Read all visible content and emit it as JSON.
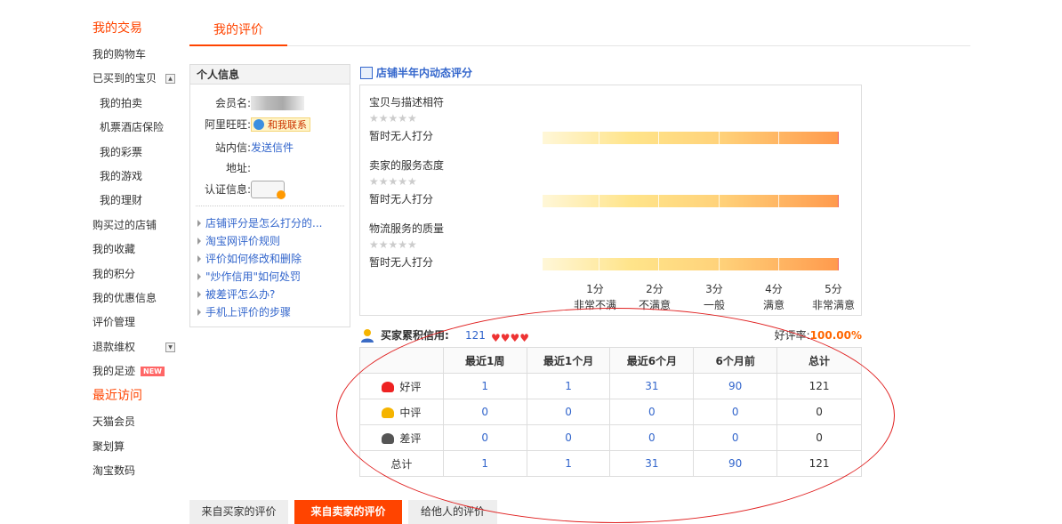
{
  "nav": {
    "heading_trade": "我的交易",
    "items": [
      {
        "label": "我的购物车",
        "sub": false
      },
      {
        "label": "已买到的宝贝",
        "sub": false,
        "toggle": "▲"
      },
      {
        "label": "我的拍卖",
        "sub": true
      },
      {
        "label": "机票酒店保险",
        "sub": true
      },
      {
        "label": "我的彩票",
        "sub": true
      },
      {
        "label": "我的游戏",
        "sub": true
      },
      {
        "label": "我的理财",
        "sub": true
      },
      {
        "label": "购买过的店铺",
        "sub": false
      },
      {
        "label": "我的收藏",
        "sub": false
      },
      {
        "label": "我的积分",
        "sub": false
      },
      {
        "label": "我的优惠信息",
        "sub": false
      },
      {
        "label": "评价管理",
        "sub": false
      },
      {
        "label": "退款维权",
        "sub": false,
        "toggle": "▼"
      },
      {
        "label": "我的足迹",
        "sub": false,
        "badge": "NEW"
      }
    ],
    "heading_recent": "最近访问",
    "recent": [
      "天猫会员",
      "聚划算",
      "淘宝数码"
    ]
  },
  "top_tab": "我的评价",
  "info": {
    "title": "个人信息",
    "member_label": "会员名:",
    "wangwang_label": "阿里旺旺:",
    "wangwang_btn": "和我联系",
    "message_label": "站内信:",
    "message_link": "发送信件",
    "address_label": "地址:",
    "cert_label": "认证信息:",
    "help": [
      "店铺评分是怎么打分的...",
      "淘宝网评价规则",
      "评价如何修改和删除",
      "\"炒作信用\"如何处罚",
      "被差评怎么办?",
      "手机上评价的步骤"
    ]
  },
  "dsr": {
    "title": "店铺半年内动态评分",
    "items": [
      {
        "name": "宝贝与描述相符",
        "stars": "★★★★★",
        "status": "暂时无人打分"
      },
      {
        "name": "卖家的服务态度",
        "stars": "★★★★★",
        "status": "暂时无人打分"
      },
      {
        "name": "物流服务的质量",
        "stars": "★★★★★",
        "status": "暂时无人打分"
      }
    ],
    "scale": [
      {
        "score": "1分",
        "desc": "非常不满"
      },
      {
        "score": "2分",
        "desc": "不满意"
      },
      {
        "score": "3分",
        "desc": "一般"
      },
      {
        "score": "4分",
        "desc": "满意"
      },
      {
        "score": "5分",
        "desc": "非常满意"
      }
    ]
  },
  "credit": {
    "label": "买家累积信用:",
    "value": "121",
    "hearts": "♥♥♥♥",
    "rate_label": "好评率:",
    "rate_value": "100.00%"
  },
  "table": {
    "headers": [
      "",
      "最近1周",
      "最近1个月",
      "最近6个月",
      "6个月前",
      "总计"
    ],
    "rows": [
      {
        "label": "好评",
        "icon": "red-flower-icon",
        "color": "#e22",
        "values": [
          "1",
          "1",
          "31",
          "90",
          "121"
        ]
      },
      {
        "label": "中评",
        "icon": "yellow-flower-icon",
        "color": "#f5b400",
        "values": [
          "0",
          "0",
          "0",
          "0",
          "0"
        ]
      },
      {
        "label": "差评",
        "icon": "bad-rating-icon",
        "color": "#555",
        "values": [
          "0",
          "0",
          "0",
          "0",
          "0"
        ]
      },
      {
        "label": "总计",
        "icon": "",
        "color": "",
        "values": [
          "1",
          "1",
          "31",
          "90",
          "121"
        ]
      }
    ]
  },
  "bottom_tabs": [
    {
      "label": "来自买家的评价",
      "active": false
    },
    {
      "label": "来自卖家的评价",
      "active": true
    },
    {
      "label": "给他人的评价",
      "active": false
    }
  ]
}
